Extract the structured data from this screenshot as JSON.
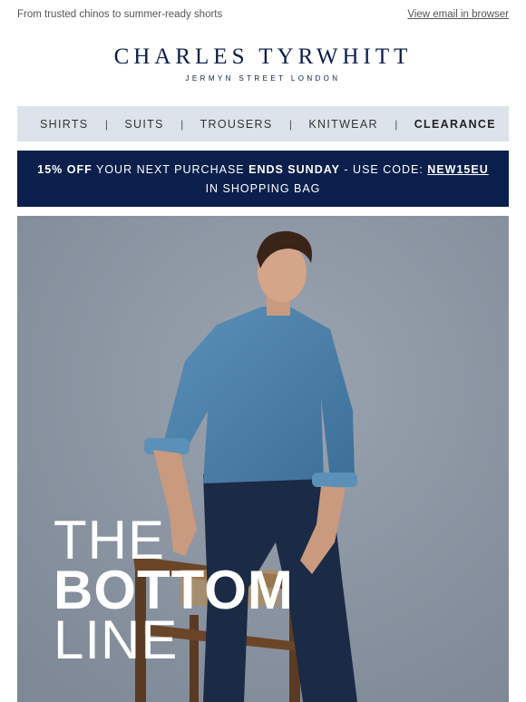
{
  "preheader": {
    "text": "From trusted chinos to summer-ready shorts",
    "view_in_browser": "View email in browser"
  },
  "brand": {
    "name": "CHARLES TYRWHITT",
    "tagline": "JERMYN STREET LONDON"
  },
  "nav": {
    "items": [
      {
        "label": "SHIRTS"
      },
      {
        "label": "SUITS"
      },
      {
        "label": "TROUSERS"
      },
      {
        "label": "KNITWEAR"
      },
      {
        "label": "CLEARANCE"
      }
    ],
    "separator": "|"
  },
  "promo": {
    "offer": "15% OFF",
    "text1": " YOUR NEXT PURCHASE ",
    "ends": "ENDS SUNDAY",
    "text2": " - USE CODE: ",
    "code": "NEW15EU",
    "text3": " IN SHOPPING BAG"
  },
  "hero": {
    "headline_line1": "THE",
    "headline_line2": "BOTTOM",
    "headline_line3": "LINE"
  },
  "colors": {
    "navy": "#0a1f4b",
    "nav_bg": "#dde3ea",
    "hero_bg": "#8d96a3",
    "shirt_blue": "#4a7fa8",
    "trousers_navy": "#1b2a45"
  }
}
